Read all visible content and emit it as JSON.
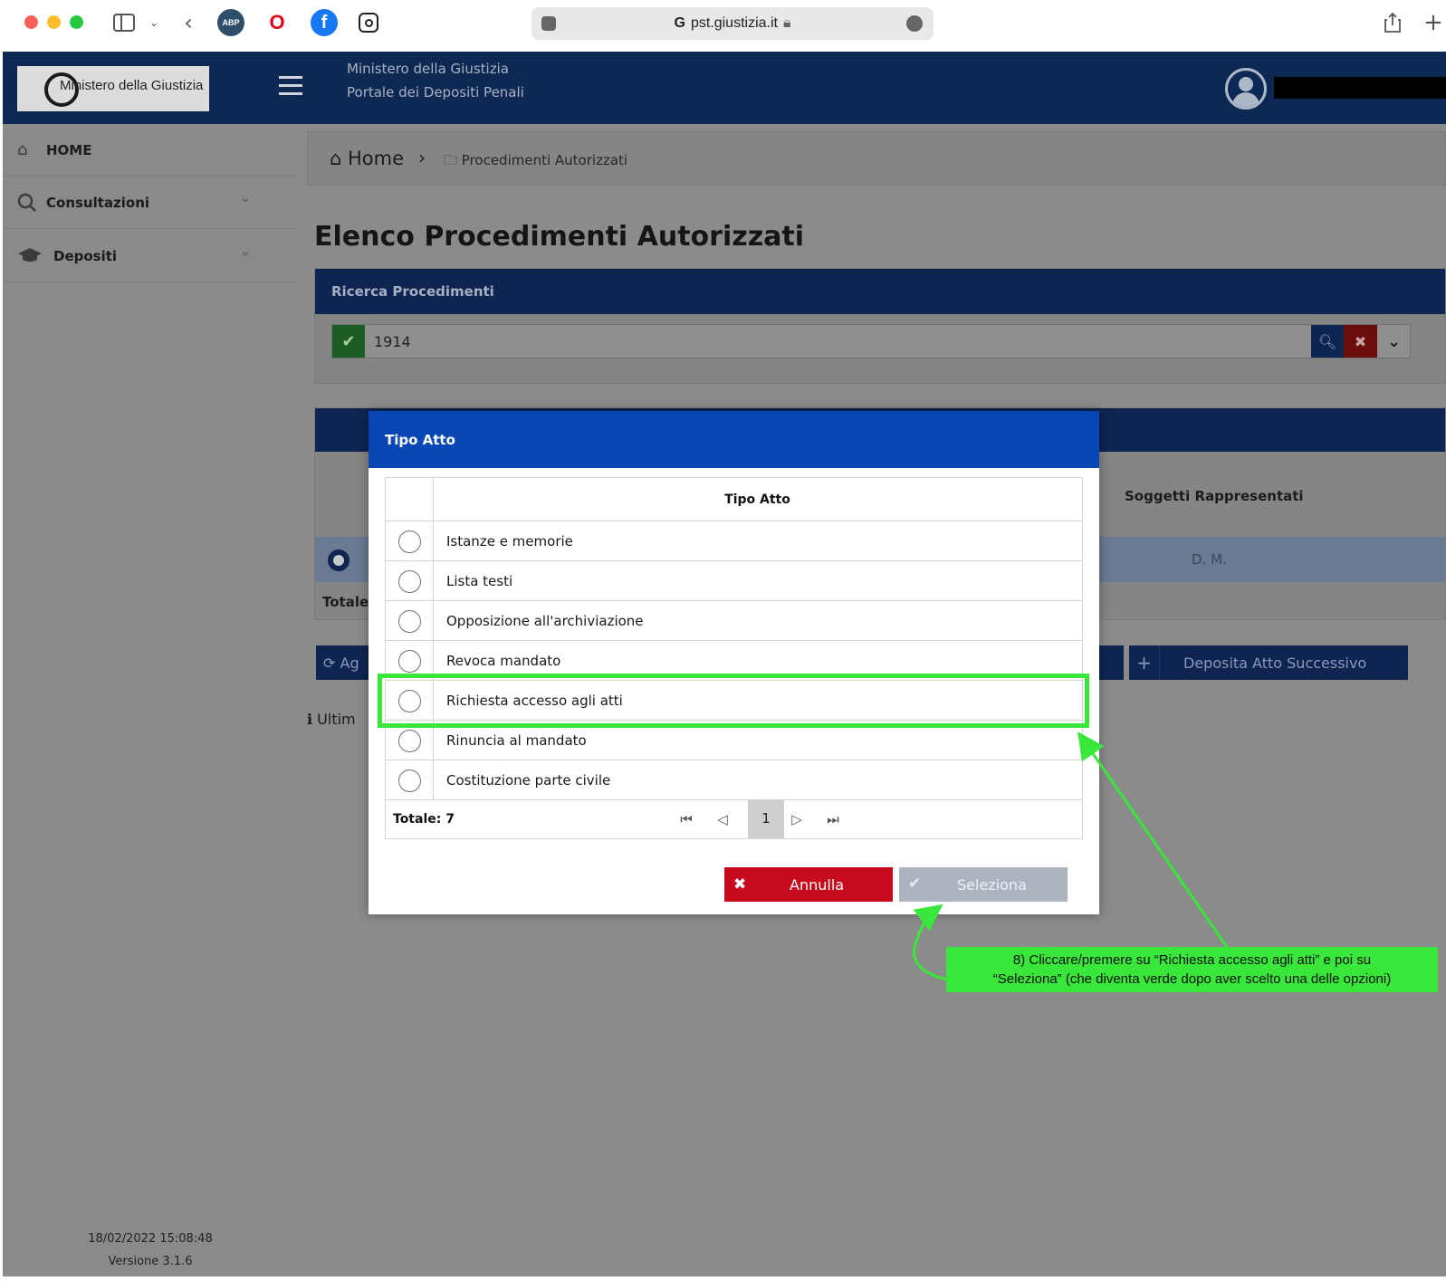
{
  "browser": {
    "url": "pst.giustizia.it",
    "extensions": [
      "ABP",
      "O",
      "f",
      "ig"
    ]
  },
  "header": {
    "logo_text": "Ministero della Giustizia",
    "line1": "Ministero della Giustizia",
    "line2": "Portale dei Depositi Penali"
  },
  "sidebar": {
    "items": [
      {
        "label": "HOME",
        "icon": "home-icon"
      },
      {
        "label": "Consultazioni",
        "icon": "search-icon"
      },
      {
        "label": "Depositi",
        "icon": "graduation-cap-icon"
      }
    ],
    "timestamp": "18/02/2022 15:08:48",
    "version": "Versione 3.1.6"
  },
  "breadcrumb": {
    "home": "Home",
    "current": "Procedimenti Autorizzati"
  },
  "page": {
    "title": "Elenco Procedimenti Autorizzati"
  },
  "search": {
    "header": "Ricerca Procedimenti",
    "value": "1914"
  },
  "results": {
    "column_soggetti": "Soggetti Rappresentati",
    "row_value": "D. M.",
    "totale_label": "Totale:",
    "btn_left_label": "Ag",
    "btn_deposita": "Deposita Atto Successivo",
    "ultimo_label": "Ultim"
  },
  "modal": {
    "title": "Tipo Atto",
    "column": "Tipo Atto",
    "options": [
      "Istanze e memorie",
      "Lista testi",
      "Opposizione all'archiviazione",
      "Revoca mandato",
      "Richiesta accesso agli atti",
      "Rinuncia al mandato",
      "Costituzione parte civile"
    ],
    "total": "Totale: 7",
    "page": "1",
    "btn_cancel": "Annulla",
    "btn_select": "Seleziona"
  },
  "annotation": {
    "line1": "8) Cliccare/premere su “Richiesta accesso agli atti” e poi su",
    "line2": "“Seleziona” (che diventa verde dopo aver scelto una delle opzioni)",
    "color": "#39e73a"
  },
  "colors": {
    "navy": "#0e2552",
    "modal_blue": "#0a47b6",
    "cancel_red": "#c80a1e",
    "select_grey": "#adb4c0"
  }
}
